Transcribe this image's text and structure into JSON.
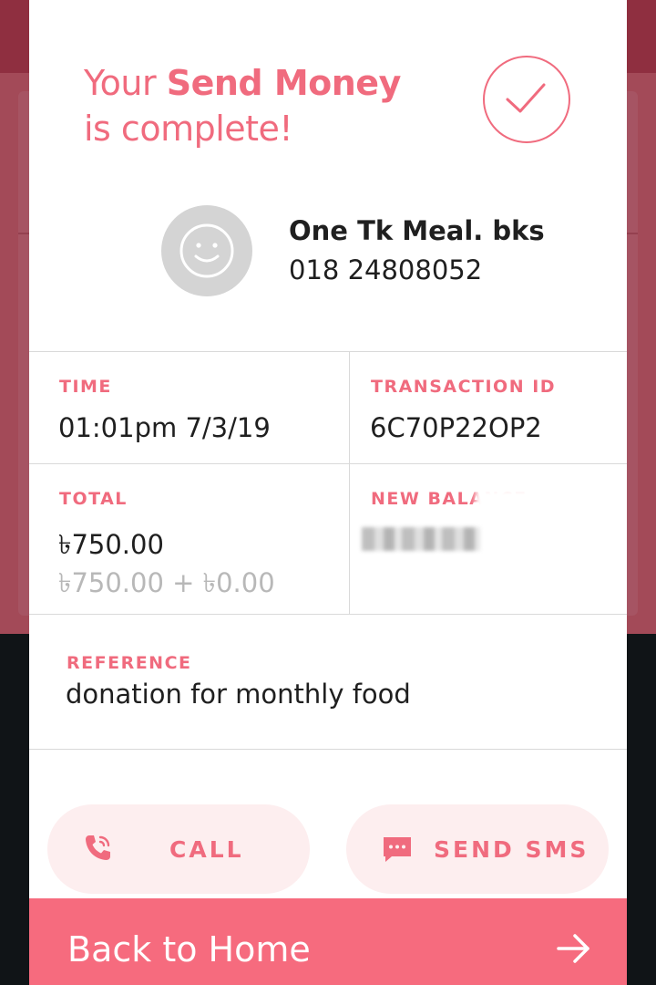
{
  "headline": {
    "prefix": "Your ",
    "bold": "Send Money",
    "suffix": "is complete!"
  },
  "recipient": {
    "name": "One Tk Meal. bks",
    "number": "018 24808052"
  },
  "details": {
    "time_label": "TIME",
    "time_value": "01:01pm 7/3/19",
    "txn_label": "TRANSACTION ID",
    "txn_value": "6C70P22OP2",
    "total_label": "TOTAL",
    "total_value": "৳750.00",
    "total_breakdown": "৳750.00 + ৳0.00",
    "balance_label": "NEW BALANCE"
  },
  "reference": {
    "label": "REFERENCE",
    "value": "donation for monthly food"
  },
  "actions": {
    "call_label": "CALL",
    "sms_label": "SEND SMS"
  },
  "footer": {
    "home_label": "Back to Home"
  },
  "colors": {
    "accent": "#f06b7e",
    "button_bg": "#fdeeef",
    "footer_bg": "#f66b7e"
  }
}
